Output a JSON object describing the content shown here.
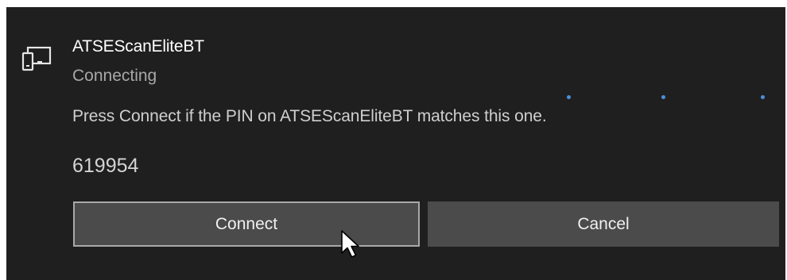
{
  "notification": {
    "device_name": "ATSEScanEliteBT",
    "status": "Connecting",
    "prompt": "Press Connect if the PIN on ATSEScanEliteBT matches this one.",
    "pin": "619954"
  },
  "buttons": {
    "connect_label": "Connect",
    "cancel_label": "Cancel"
  },
  "icons": {
    "device": "device-icon",
    "cursor": "mouse-pointer-icon"
  },
  "colors": {
    "background": "#1f1f1f",
    "button": "#4b4b4b",
    "focus_border": "#a9a9a9",
    "progress_dot": "#4a90d9"
  }
}
